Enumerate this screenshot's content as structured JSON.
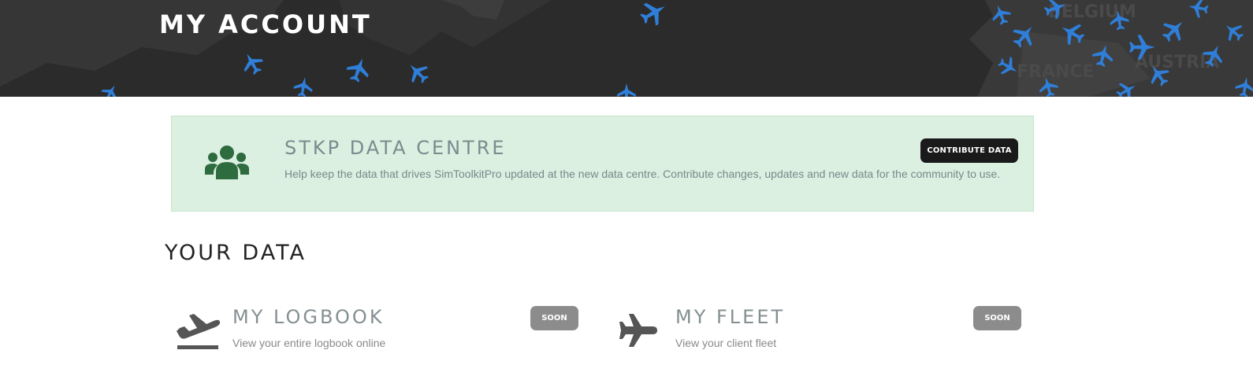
{
  "header": {
    "title": "MY ACCOUNT",
    "background_map_labels": [
      "BELGIUM",
      "FRANCE",
      "AUSTRIA"
    ],
    "plane_color": "#2f7ed8"
  },
  "data_centre": {
    "icon": "users-group-icon",
    "title": "STKP DATA CENTRE",
    "description": "Help keep the data that drives SimToolkitPro updated at the new data centre. Contribute changes, updates and new data for the community to use.",
    "button_label": "CONTRIBUTE DATA",
    "background_color": "#dbf0e1",
    "icon_color": "#2e6b3f"
  },
  "your_data": {
    "title": "YOUR DATA",
    "items": [
      {
        "icon": "plane-departure-icon",
        "title": "MY LOGBOOK",
        "description": "View your entire logbook online",
        "badge": "SOON"
      },
      {
        "icon": "plane-icon",
        "title": "MY FLEET",
        "description": "View your client fleet",
        "badge": "SOON"
      }
    ]
  }
}
